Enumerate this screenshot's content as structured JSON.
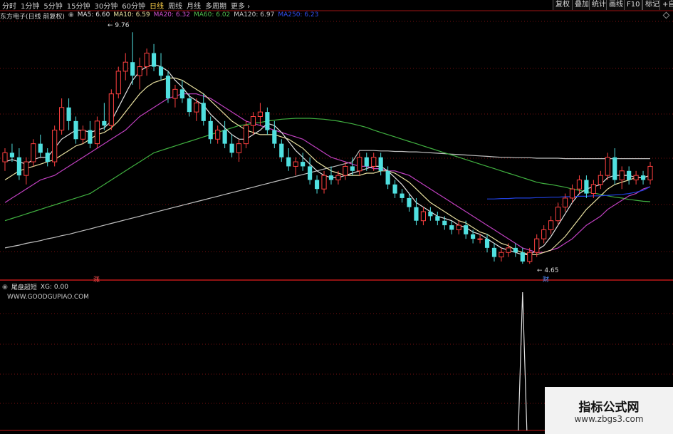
{
  "toolbar": {
    "periods": [
      "分时",
      "1分钟",
      "5分钟",
      "15分钟",
      "30分钟",
      "60分钟",
      "日线",
      "周线",
      "月线",
      "多周期",
      "更多 ›"
    ],
    "active_index": 6,
    "right_buttons": [
      "复权",
      "叠加",
      "统计",
      "画线",
      "F10",
      "标记",
      "+自"
    ]
  },
  "info": {
    "stock": "东方电子(日线 前复权)",
    "ma5": "MA5: 6.60",
    "ma10": "MA10: 6.59",
    "ma20": "MA20: 6.32",
    "ma60": "MA60: 6.02",
    "ma120": "MA120: 6.97",
    "ma250": "MA250: 6.23"
  },
  "colors": {
    "ma5": "#e0e0e0",
    "ma10": "#e8e0a0",
    "ma20": "#c040c0",
    "ma60": "#40b040",
    "ma120": "#c0c0c0",
    "ma250": "#2040e0",
    "up": "#ff4040",
    "down": "#50e0e0",
    "grid": "#7a1010",
    "active_tab": "#ffd24a"
  },
  "annotations": {
    "high": "9.76",
    "low": "4.65",
    "zhang": "涨",
    "cai": "财"
  },
  "sub": {
    "name": "尾盘超短",
    "xg": "XG: 0.00",
    "site": "WWW.GOODGUPIAO.COM"
  },
  "watermark": {
    "title": "指标公式网",
    "url": "www.zbgs3.com"
  },
  "chart_data": {
    "type": "candlestick",
    "price_range": [
      4.4,
      10.0
    ],
    "candles": [
      [
        6.9,
        7.2,
        6.7,
        7.1
      ],
      [
        7.1,
        7.3,
        6.9,
        7.0
      ],
      [
        7.0,
        7.2,
        6.5,
        6.6
      ],
      [
        6.6,
        7.0,
        6.4,
        6.9
      ],
      [
        6.9,
        7.4,
        6.8,
        7.3
      ],
      [
        7.3,
        7.5,
        7.0,
        7.1
      ],
      [
        7.1,
        7.2,
        6.8,
        6.9
      ],
      [
        6.9,
        7.7,
        6.8,
        7.6
      ],
      [
        7.6,
        8.3,
        7.5,
        8.1
      ],
      [
        8.1,
        8.3,
        7.6,
        7.8
      ],
      [
        7.8,
        7.9,
        7.3,
        7.4
      ],
      [
        7.4,
        7.7,
        7.3,
        7.6
      ],
      [
        7.6,
        7.8,
        7.2,
        7.3
      ],
      [
        7.3,
        7.9,
        7.2,
        7.8
      ],
      [
        7.8,
        8.2,
        7.6,
        7.7
      ],
      [
        7.7,
        8.5,
        7.6,
        8.4
      ],
      [
        8.4,
        9.0,
        8.3,
        8.9
      ],
      [
        8.9,
        9.3,
        8.7,
        9.1
      ],
      [
        9.1,
        9.76,
        8.6,
        8.8
      ],
      [
        8.8,
        9.2,
        8.5,
        9.0
      ],
      [
        9.0,
        9.4,
        8.8,
        9.3
      ],
      [
        9.3,
        9.5,
        8.9,
        9.0
      ],
      [
        9.0,
        9.3,
        8.7,
        8.8
      ],
      [
        8.8,
        8.9,
        8.2,
        8.3
      ],
      [
        8.3,
        8.6,
        8.1,
        8.5
      ],
      [
        8.5,
        8.7,
        8.2,
        8.3
      ],
      [
        8.3,
        8.4,
        7.9,
        8.0
      ],
      [
        8.0,
        8.3,
        7.8,
        8.2
      ],
      [
        8.2,
        8.4,
        7.7,
        7.8
      ],
      [
        7.8,
        7.9,
        7.3,
        7.4
      ],
      [
        7.4,
        7.7,
        7.3,
        7.6
      ],
      [
        7.6,
        7.8,
        7.2,
        7.3
      ],
      [
        7.3,
        7.5,
        7.0,
        7.1
      ],
      [
        7.1,
        7.4,
        6.9,
        7.3
      ],
      [
        7.3,
        7.8,
        7.2,
        7.7
      ],
      [
        7.7,
        8.0,
        7.5,
        7.9
      ],
      [
        7.9,
        8.2,
        7.7,
        8.0
      ],
      [
        8.0,
        8.1,
        7.5,
        7.6
      ],
      [
        7.6,
        7.8,
        7.2,
        7.3
      ],
      [
        7.3,
        7.4,
        6.9,
        7.0
      ],
      [
        7.0,
        7.2,
        6.7,
        6.8
      ],
      [
        6.8,
        7.0,
        6.6,
        6.9
      ],
      [
        6.9,
        7.1,
        6.7,
        6.8
      ],
      [
        6.8,
        7.0,
        6.4,
        6.5
      ],
      [
        6.5,
        6.6,
        6.2,
        6.3
      ],
      [
        6.3,
        6.7,
        6.2,
        6.6
      ],
      [
        6.6,
        6.8,
        6.4,
        6.5
      ],
      [
        6.5,
        6.7,
        6.4,
        6.6
      ],
      [
        6.6,
        6.9,
        6.5,
        6.8
      ],
      [
        6.8,
        7.0,
        6.6,
        6.7
      ],
      [
        6.7,
        7.1,
        6.6,
        7.0
      ],
      [
        7.0,
        7.1,
        6.7,
        6.8
      ],
      [
        6.8,
        7.1,
        6.7,
        7.0
      ],
      [
        7.0,
        7.1,
        6.6,
        6.7
      ],
      [
        6.7,
        6.8,
        6.3,
        6.4
      ],
      [
        6.4,
        6.5,
        6.1,
        6.2
      ],
      [
        6.2,
        6.3,
        6.0,
        6.1
      ],
      [
        6.1,
        6.2,
        5.8,
        5.9
      ],
      [
        5.9,
        6.1,
        5.5,
        5.6
      ],
      [
        5.6,
        5.9,
        5.5,
        5.8
      ],
      [
        5.8,
        5.9,
        5.6,
        5.7
      ],
      [
        5.7,
        5.8,
        5.5,
        5.6
      ],
      [
        5.6,
        5.7,
        5.4,
        5.5
      ],
      [
        5.5,
        5.6,
        5.3,
        5.4
      ],
      [
        5.4,
        5.6,
        5.3,
        5.5
      ],
      [
        5.5,
        5.6,
        5.2,
        5.3
      ],
      [
        5.3,
        5.4,
        5.1,
        5.2
      ],
      [
        5.2,
        5.3,
        5.1,
        5.2
      ],
      [
        5.2,
        5.3,
        4.9,
        5.0
      ],
      [
        5.0,
        5.1,
        4.7,
        4.8
      ],
      [
        4.8,
        5.0,
        4.7,
        4.9
      ],
      [
        4.9,
        5.1,
        4.8,
        5.0
      ],
      [
        5.0,
        5.1,
        4.8,
        4.9
      ],
      [
        4.9,
        5.0,
        4.65,
        4.7
      ],
      [
        4.7,
        5.0,
        4.65,
        4.9
      ],
      [
        4.9,
        5.3,
        4.8,
        5.2
      ],
      [
        5.2,
        5.5,
        5.1,
        5.4
      ],
      [
        5.4,
        5.7,
        5.3,
        5.6
      ],
      [
        5.6,
        6.0,
        5.5,
        5.9
      ],
      [
        5.9,
        6.2,
        5.8,
        6.1
      ],
      [
        6.1,
        6.4,
        6.0,
        6.3
      ],
      [
        6.3,
        6.6,
        6.2,
        6.5
      ],
      [
        6.5,
        6.6,
        6.1,
        6.2
      ],
      [
        6.2,
        6.5,
        6.1,
        6.4
      ],
      [
        6.4,
        6.7,
        6.3,
        6.6
      ],
      [
        6.6,
        7.1,
        6.5,
        7.0
      ],
      [
        7.0,
        7.2,
        6.4,
        6.5
      ],
      [
        6.5,
        6.8,
        6.3,
        6.7
      ],
      [
        6.7,
        6.8,
        6.4,
        6.5
      ],
      [
        6.5,
        6.7,
        6.4,
        6.6
      ],
      [
        6.6,
        6.7,
        6.4,
        6.5
      ],
      [
        6.5,
        6.9,
        6.4,
        6.8
      ]
    ],
    "ma": {
      "ma5": [
        6.9,
        6.95,
        6.9,
        6.85,
        6.95,
        7.0,
        7.0,
        7.2,
        7.4,
        7.5,
        7.6,
        7.6,
        7.55,
        7.6,
        7.65,
        7.8,
        8.1,
        8.4,
        8.7,
        8.9,
        9.0,
        9.05,
        9.0,
        8.9,
        8.7,
        8.55,
        8.35,
        8.25,
        8.15,
        7.95,
        7.8,
        7.65,
        7.5,
        7.4,
        7.4,
        7.5,
        7.6,
        7.75,
        7.7,
        7.55,
        7.35,
        7.15,
        7.0,
        6.85,
        6.7,
        6.6,
        6.55,
        6.55,
        6.6,
        6.65,
        6.7,
        6.75,
        6.8,
        6.8,
        6.7,
        6.55,
        6.4,
        6.2,
        6.0,
        5.9,
        5.8,
        5.7,
        5.65,
        5.6,
        5.5,
        5.45,
        5.35,
        5.3,
        5.2,
        5.1,
        5.0,
        4.95,
        4.9,
        4.85,
        4.85,
        4.95,
        5.05,
        5.25,
        5.5,
        5.75,
        6.0,
        6.2,
        6.3,
        6.35,
        6.4,
        6.55,
        6.6,
        6.6,
        6.6,
        6.55,
        6.55,
        6.6
      ],
      "ma10": [
        6.5,
        6.6,
        6.7,
        6.75,
        6.8,
        6.85,
        6.9,
        6.95,
        7.05,
        7.15,
        7.25,
        7.3,
        7.4,
        7.5,
        7.55,
        7.65,
        7.8,
        8.0,
        8.2,
        8.4,
        8.55,
        8.65,
        8.7,
        8.75,
        8.75,
        8.7,
        8.6,
        8.5,
        8.4,
        8.25,
        8.1,
        7.95,
        7.8,
        7.7,
        7.6,
        7.55,
        7.5,
        7.5,
        7.5,
        7.45,
        7.4,
        7.3,
        7.2,
        7.05,
        6.9,
        6.8,
        6.7,
        6.65,
        6.6,
        6.6,
        6.6,
        6.65,
        6.65,
        6.7,
        6.7,
        6.65,
        6.55,
        6.45,
        6.3,
        6.15,
        6.0,
        5.9,
        5.8,
        5.7,
        5.6,
        5.55,
        5.45,
        5.35,
        5.3,
        5.2,
        5.1,
        5.05,
        4.95,
        4.9,
        4.85,
        4.85,
        4.9,
        4.95,
        5.1,
        5.25,
        5.45,
        5.65,
        5.85,
        6.0,
        6.15,
        6.3,
        6.4,
        6.45,
        6.5,
        6.55,
        6.55,
        6.6
      ],
      "ma20": [
        6.0,
        6.1,
        6.2,
        6.3,
        6.4,
        6.5,
        6.55,
        6.6,
        6.7,
        6.8,
        6.9,
        7.0,
        7.1,
        7.2,
        7.3,
        7.4,
        7.5,
        7.6,
        7.75,
        7.9,
        8.0,
        8.1,
        8.2,
        8.3,
        8.35,
        8.4,
        8.4,
        8.4,
        8.35,
        8.3,
        8.2,
        8.1,
        8.0,
        7.9,
        7.8,
        7.75,
        7.7,
        7.65,
        7.6,
        7.55,
        7.5,
        7.45,
        7.4,
        7.3,
        7.2,
        7.1,
        7.0,
        6.95,
        6.9,
        6.85,
        6.8,
        6.8,
        6.75,
        6.75,
        6.7,
        6.7,
        6.65,
        6.6,
        6.5,
        6.4,
        6.3,
        6.2,
        6.1,
        6.0,
        5.9,
        5.8,
        5.7,
        5.6,
        5.5,
        5.4,
        5.3,
        5.2,
        5.1,
        5.0,
        4.95,
        4.9,
        4.9,
        4.95,
        5.0,
        5.1,
        5.2,
        5.35,
        5.5,
        5.6,
        5.7,
        5.85,
        5.95,
        6.05,
        6.15,
        6.2,
        6.3,
        6.35
      ],
      "ma60": [
        5.6,
        5.65,
        5.7,
        5.75,
        5.8,
        5.85,
        5.9,
        5.95,
        6.0,
        6.05,
        6.1,
        6.15,
        6.2,
        6.3,
        6.4,
        6.5,
        6.6,
        6.7,
        6.8,
        6.9,
        7.0,
        7.1,
        7.15,
        7.2,
        7.25,
        7.3,
        7.35,
        7.4,
        7.45,
        7.5,
        7.55,
        7.6,
        7.65,
        7.7,
        7.72,
        7.75,
        7.77,
        7.8,
        7.82,
        7.84,
        7.85,
        7.86,
        7.86,
        7.86,
        7.85,
        7.84,
        7.82,
        7.8,
        7.77,
        7.74,
        7.7,
        7.66,
        7.6,
        7.55,
        7.5,
        7.45,
        7.4,
        7.35,
        7.3,
        7.25,
        7.2,
        7.15,
        7.1,
        7.05,
        7.0,
        6.95,
        6.9,
        6.85,
        6.8,
        6.75,
        6.7,
        6.65,
        6.6,
        6.55,
        6.5,
        6.45,
        6.42,
        6.4,
        6.37,
        6.34,
        6.3,
        6.27,
        6.24,
        6.21,
        6.18,
        6.15,
        6.12,
        6.1,
        6.07,
        6.05,
        6.03,
        6.02
      ],
      "ma120": [
        5.0,
        5.03,
        5.06,
        5.1,
        5.13,
        5.16,
        5.2,
        5.23,
        5.27,
        5.3,
        5.34,
        5.38,
        5.42,
        5.46,
        5.5,
        5.54,
        5.58,
        5.62,
        5.66,
        5.7,
        5.74,
        5.78,
        5.82,
        5.86,
        5.9,
        5.94,
        5.98,
        6.02,
        6.06,
        6.1,
        6.14,
        6.18,
        6.22,
        6.26,
        6.3,
        6.34,
        6.38,
        6.42,
        6.46,
        6.5,
        6.54,
        6.58,
        6.62,
        6.66,
        6.7,
        6.74,
        6.78,
        6.82,
        6.86,
        6.9,
        7.15,
        7.15,
        7.15,
        7.14,
        7.14,
        7.13,
        7.13,
        7.12,
        7.12,
        7.11,
        7.1,
        7.09,
        7.08,
        7.07,
        7.06,
        7.05,
        7.04,
        7.03,
        7.02,
        7.01,
        7.0,
        7.0,
        6.99,
        6.99,
        6.99,
        6.98,
        6.98,
        6.98,
        6.98,
        6.97,
        6.97,
        6.97,
        6.97,
        6.97,
        6.97,
        6.97,
        6.97,
        6.97,
        6.97,
        6.97,
        6.97,
        6.97
      ],
      "ma250_start": 68,
      "ma250": [
        6.08,
        6.08,
        6.09,
        6.09,
        6.1,
        6.1,
        6.1,
        6.11,
        6.11,
        6.12,
        6.12,
        6.13,
        6.13,
        6.14,
        6.14,
        6.15,
        6.15,
        6.16,
        6.17,
        6.18,
        6.2,
        6.23,
        6.27,
        6.35
      ]
    },
    "signal": {
      "index": 73,
      "value": 1
    }
  }
}
